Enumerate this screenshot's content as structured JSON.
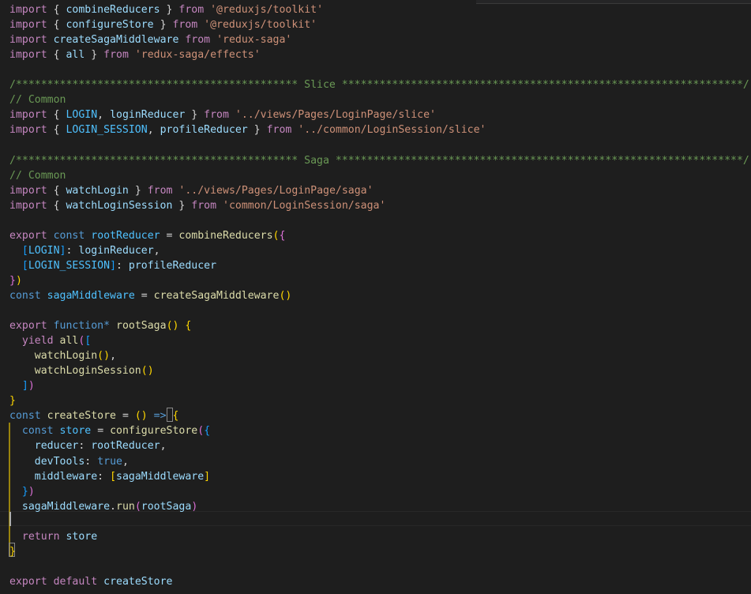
{
  "editor": {
    "language": "javascript",
    "theme_colors": {
      "background": "#1e1e1e",
      "keyword": "#c586c0",
      "storage": "#569cd6",
      "variable": "#9cdcfe",
      "constant": "#4fc1ff",
      "function": "#dcdcaa",
      "string": "#ce9178",
      "comment": "#6a9955",
      "punctuation": "#d4d4d4",
      "bracket_level_1": "#ffd700",
      "bracket_level_2": "#da70d6",
      "bracket_level_3": "#179fff"
    },
    "lines": [
      [
        [
          "keyword",
          "import"
        ],
        [
          "punct",
          " { "
        ],
        [
          "variable",
          "combineReducers"
        ],
        [
          "punct",
          " } "
        ],
        [
          "keyword",
          "from"
        ],
        [
          "punct",
          " "
        ],
        [
          "string",
          "'@reduxjs/toolkit'"
        ]
      ],
      [
        [
          "keyword",
          "import"
        ],
        [
          "punct",
          " { "
        ],
        [
          "variable",
          "configureStore"
        ],
        [
          "punct",
          " } "
        ],
        [
          "keyword",
          "from"
        ],
        [
          "punct",
          " "
        ],
        [
          "string",
          "'@reduxjs/toolkit'"
        ]
      ],
      [
        [
          "keyword",
          "import"
        ],
        [
          "punct",
          " "
        ],
        [
          "variable",
          "createSagaMiddleware"
        ],
        [
          "punct",
          " "
        ],
        [
          "keyword",
          "from"
        ],
        [
          "punct",
          " "
        ],
        [
          "string",
          "'redux-saga'"
        ]
      ],
      [
        [
          "keyword",
          "import"
        ],
        [
          "punct",
          " { "
        ],
        [
          "variable",
          "all"
        ],
        [
          "punct",
          " } "
        ],
        [
          "keyword",
          "from"
        ],
        [
          "punct",
          " "
        ],
        [
          "string",
          "'redux-saga/effects'"
        ]
      ],
      [],
      [
        [
          "comment",
          "/********************************************* Slice ****************************************************************/"
        ]
      ],
      [
        [
          "comment",
          "// Common"
        ]
      ],
      [
        [
          "keyword",
          "import"
        ],
        [
          "punct",
          " { "
        ],
        [
          "constant",
          "LOGIN"
        ],
        [
          "punct",
          ", "
        ],
        [
          "variable",
          "loginReducer"
        ],
        [
          "punct",
          " } "
        ],
        [
          "keyword",
          "from"
        ],
        [
          "punct",
          " "
        ],
        [
          "string",
          "'../views/Pages/LoginPage/slice'"
        ]
      ],
      [
        [
          "keyword",
          "import"
        ],
        [
          "punct",
          " { "
        ],
        [
          "constant",
          "LOGIN_SESSION"
        ],
        [
          "punct",
          ", "
        ],
        [
          "variable",
          "profileReducer"
        ],
        [
          "punct",
          " } "
        ],
        [
          "keyword",
          "from"
        ],
        [
          "punct",
          " "
        ],
        [
          "string",
          "'../common/LoginSession/slice'"
        ]
      ],
      [],
      [
        [
          "comment",
          "/********************************************* Saga *****************************************************************/"
        ]
      ],
      [
        [
          "comment",
          "// Common"
        ]
      ],
      [
        [
          "keyword",
          "import"
        ],
        [
          "punct",
          " { "
        ],
        [
          "variable",
          "watchLogin"
        ],
        [
          "punct",
          " } "
        ],
        [
          "keyword",
          "from"
        ],
        [
          "punct",
          " "
        ],
        [
          "string",
          "'../views/Pages/LoginPage/saga'"
        ]
      ],
      [
        [
          "keyword",
          "import"
        ],
        [
          "punct",
          " { "
        ],
        [
          "variable",
          "watchLoginSession"
        ],
        [
          "punct",
          " } "
        ],
        [
          "keyword",
          "from"
        ],
        [
          "punct",
          " "
        ],
        [
          "string",
          "'common/LoginSession/saga'"
        ]
      ],
      [],
      [
        [
          "keyword",
          "export"
        ],
        [
          "punct",
          " "
        ],
        [
          "storage",
          "const"
        ],
        [
          "punct",
          " "
        ],
        [
          "constant",
          "rootReducer"
        ],
        [
          "operator",
          " = "
        ],
        [
          "function",
          "combineReducers"
        ],
        [
          "brace1",
          "("
        ],
        [
          "brace2",
          "{"
        ]
      ],
      [
        [
          "punct",
          "  "
        ],
        [
          "brace3",
          "["
        ],
        [
          "constant",
          "LOGIN"
        ],
        [
          "brace3",
          "]"
        ],
        [
          "punct",
          ": "
        ],
        [
          "variable",
          "loginReducer"
        ],
        [
          "punct",
          ","
        ]
      ],
      [
        [
          "punct",
          "  "
        ],
        [
          "brace3",
          "["
        ],
        [
          "constant",
          "LOGIN_SESSION"
        ],
        [
          "brace3",
          "]"
        ],
        [
          "punct",
          ": "
        ],
        [
          "variable",
          "profileReducer"
        ]
      ],
      [
        [
          "brace2",
          "}"
        ],
        [
          "brace1",
          ")"
        ]
      ],
      [
        [
          "storage",
          "const"
        ],
        [
          "punct",
          " "
        ],
        [
          "constant",
          "sagaMiddleware"
        ],
        [
          "operator",
          " = "
        ],
        [
          "function",
          "createSagaMiddleware"
        ],
        [
          "brace1",
          "()"
        ]
      ],
      [],
      [
        [
          "keyword",
          "export"
        ],
        [
          "punct",
          " "
        ],
        [
          "storage",
          "function"
        ],
        [
          "storage",
          "*"
        ],
        [
          "punct",
          " "
        ],
        [
          "function",
          "rootSaga"
        ],
        [
          "brace1",
          "()"
        ],
        [
          "punct",
          " "
        ],
        [
          "brace1",
          "{"
        ]
      ],
      [
        [
          "punct",
          "  "
        ],
        [
          "keyword",
          "yield"
        ],
        [
          "punct",
          " "
        ],
        [
          "function",
          "all"
        ],
        [
          "brace2",
          "("
        ],
        [
          "brace3",
          "["
        ]
      ],
      [
        [
          "punct",
          "    "
        ],
        [
          "function",
          "watchLogin"
        ],
        [
          "brace1",
          "()"
        ],
        [
          "punct",
          ","
        ]
      ],
      [
        [
          "punct",
          "    "
        ],
        [
          "function",
          "watchLoginSession"
        ],
        [
          "brace1",
          "()"
        ]
      ],
      [
        [
          "punct",
          "  "
        ],
        [
          "brace3",
          "]"
        ],
        [
          "brace2",
          ")"
        ]
      ],
      [
        [
          "brace1",
          "}"
        ]
      ],
      [
        [
          "storage",
          "const"
        ],
        [
          "punct",
          " "
        ],
        [
          "function",
          "createStore"
        ],
        [
          "operator",
          " = "
        ],
        [
          "brace1",
          "()"
        ],
        [
          "punct",
          " "
        ],
        [
          "storage",
          "=>"
        ],
        [
          "punct",
          " "
        ],
        [
          "brace1",
          "{"
        ]
      ],
      [
        [
          "punct",
          "  "
        ],
        [
          "storage",
          "const"
        ],
        [
          "punct",
          " "
        ],
        [
          "constant",
          "store"
        ],
        [
          "operator",
          " = "
        ],
        [
          "function",
          "configureStore"
        ],
        [
          "brace2",
          "("
        ],
        [
          "brace3",
          "{"
        ]
      ],
      [
        [
          "punct",
          "    "
        ],
        [
          "variable",
          "reducer"
        ],
        [
          "punct",
          ": "
        ],
        [
          "variable",
          "rootReducer"
        ],
        [
          "punct",
          ","
        ]
      ],
      [
        [
          "punct",
          "    "
        ],
        [
          "variable",
          "devTools"
        ],
        [
          "punct",
          ": "
        ],
        [
          "boolean",
          "true"
        ],
        [
          "punct",
          ","
        ]
      ],
      [
        [
          "punct",
          "    "
        ],
        [
          "variable",
          "middleware"
        ],
        [
          "punct",
          ": "
        ],
        [
          "brace1",
          "["
        ],
        [
          "variable",
          "sagaMiddleware"
        ],
        [
          "brace1",
          "]"
        ]
      ],
      [
        [
          "punct",
          "  "
        ],
        [
          "brace3",
          "}"
        ],
        [
          "brace2",
          ")"
        ]
      ],
      [
        [
          "punct",
          "  "
        ],
        [
          "variable",
          "sagaMiddleware"
        ],
        [
          "punct",
          "."
        ],
        [
          "function",
          "run"
        ],
        [
          "brace2",
          "("
        ],
        [
          "variable",
          "rootSaga"
        ],
        [
          "brace2",
          ")"
        ]
      ],
      [],
      [
        [
          "punct",
          "  "
        ],
        [
          "keyword",
          "return"
        ],
        [
          "punct",
          " "
        ],
        [
          "variable",
          "store"
        ]
      ],
      [
        [
          "brace1",
          "}"
        ]
      ],
      [],
      [
        [
          "keyword",
          "export"
        ],
        [
          "punct",
          " "
        ],
        [
          "keyword",
          "default"
        ],
        [
          "punct",
          " "
        ],
        [
          "variable",
          "createStore"
        ]
      ]
    ]
  }
}
